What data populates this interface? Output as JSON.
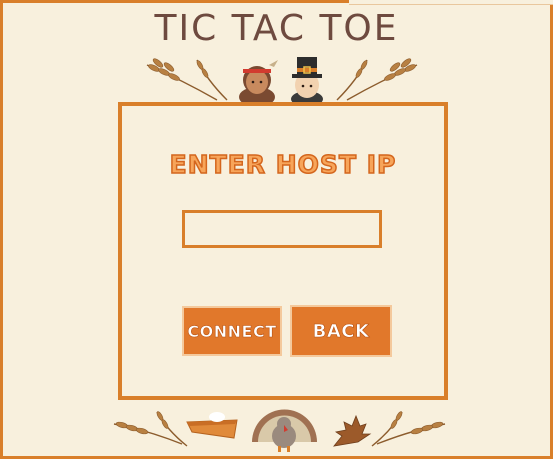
{
  "title": "TIC TAC TOE",
  "dialog": {
    "heading": "ENTER HOST IP",
    "input_value": "",
    "input_placeholder": "",
    "connect_label": "CONNECT",
    "back_label": "BACK"
  },
  "colors": {
    "background": "#f8f0dd",
    "accent": "#d97f2a",
    "title": "#6e4a3f",
    "button": "#e1782b"
  },
  "icons": [
    "wheat-icon",
    "native-girl-icon",
    "pilgrim-icon",
    "pie-icon",
    "turkey-icon",
    "oak-leaf-icon"
  ]
}
